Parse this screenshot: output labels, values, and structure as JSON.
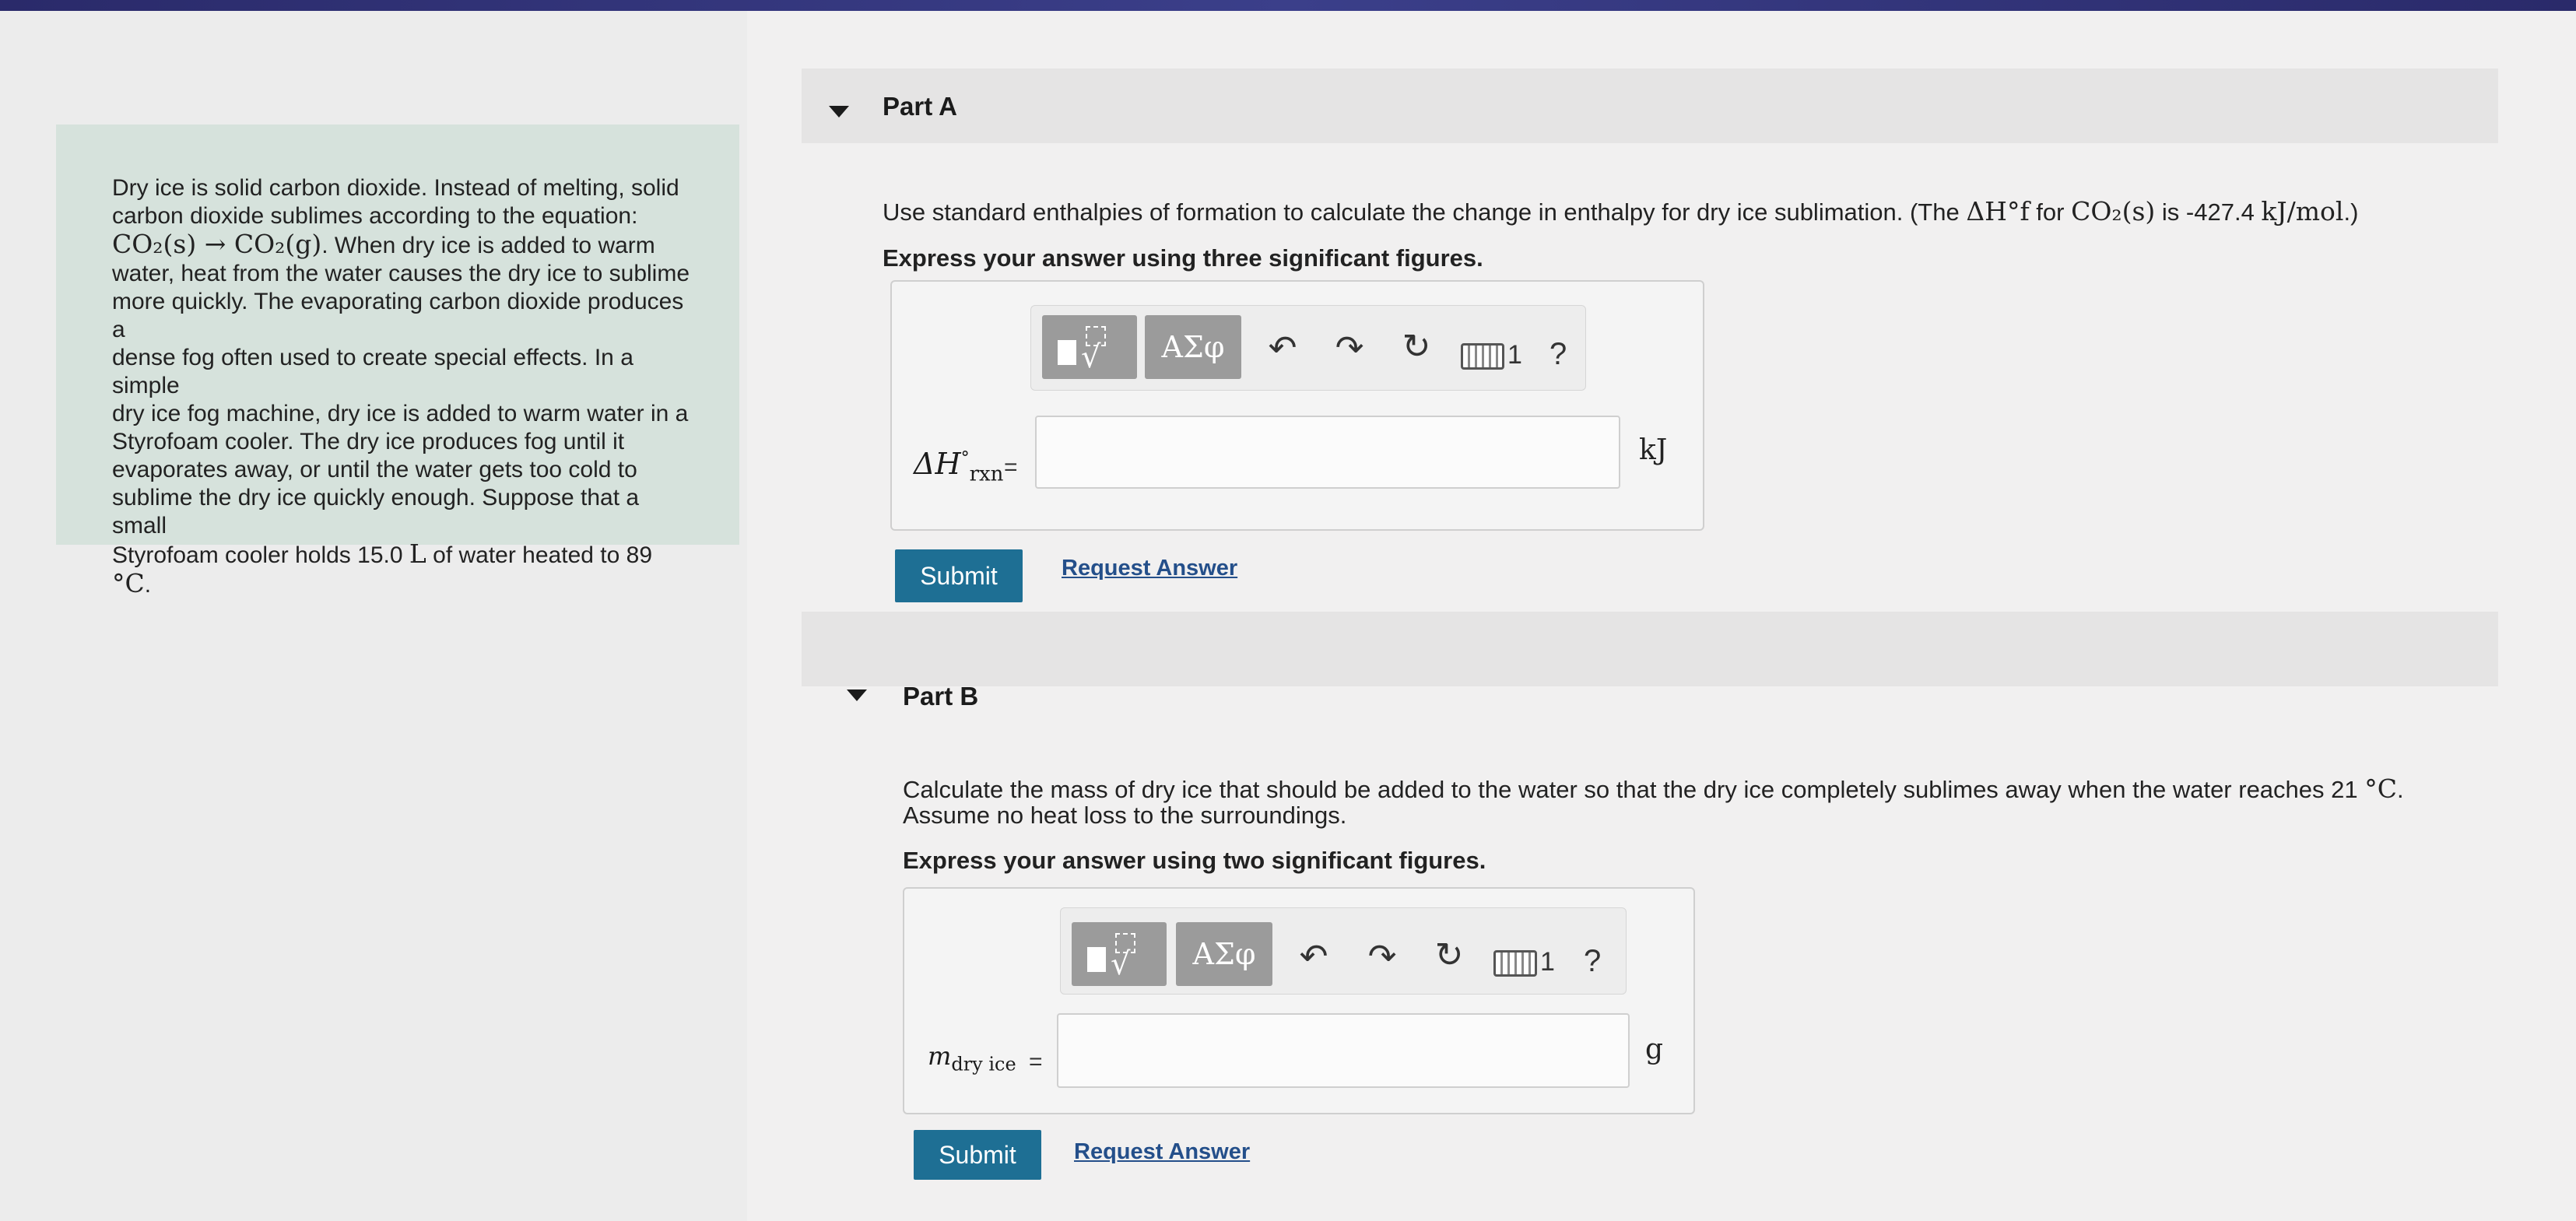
{
  "intro": {
    "lines": [
      "Dry ice is solid carbon dioxide. Instead of melting, solid",
      "carbon dioxide sublimes according to the equation:"
    ],
    "equation": "CO₂(s) → CO₂(g)",
    "equation_tail": ". When dry ice is added to warm",
    "lines2": [
      "water, heat from the water causes the dry ice to sublime",
      "more quickly. The evaporating carbon dioxide produces a",
      "dense fog often used to create special effects. In a simple",
      "dry ice fog machine, dry ice is added to warm water in a",
      "Styrofoam cooler. The dry ice produces fog until it",
      "evaporates away, or until the water gets too cold to",
      "sublime the dry ice quickly enough. Suppose that a small"
    ],
    "last_line_prefix": "Styrofoam cooler holds 15.0 ",
    "last_line_L": "L",
    "last_line_mid": " of water heated to 89 ",
    "last_line_unit": "°C",
    "last_line_end": "."
  },
  "partA": {
    "title": "Part A",
    "question_prefix": "Use standard enthalpies of formation to calculate the change in enthalpy for dry ice sublimation. (The ",
    "question_math1": "ΔH°f",
    "question_mid": " for ",
    "question_math2": "CO₂(s)",
    "question_is": " is -427.4 ",
    "question_unit": "kJ/mol",
    "question_end": ".)",
    "instruction": "Express your answer using three significant figures.",
    "symbols_label": "ΑΣφ",
    "kb_num": "1",
    "help": "?",
    "label_main": "ΔH",
    "label_sup": "°",
    "label_sub": "rxn",
    "equals": "=",
    "input_value": "",
    "unit": "kJ",
    "submit": "Submit",
    "request": "Request Answer"
  },
  "partB": {
    "title": "Part B",
    "question_line1_prefix": "Calculate the mass of dry ice that should be added to the water so that the dry ice completely sublimes away when the water reaches 21 ",
    "question_line1_unit": "°C",
    "question_line1_end": ".",
    "question_line2": "Assume no heat loss to the surroundings.",
    "instruction": "Express your answer using two significant figures.",
    "symbols_label": "ΑΣφ",
    "kb_num": "1",
    "help": "?",
    "label_main": "m",
    "label_sub": "dry ice",
    "equals": "=",
    "input_value": "",
    "unit": "g",
    "submit": "Submit",
    "request": "Request Answer"
  }
}
